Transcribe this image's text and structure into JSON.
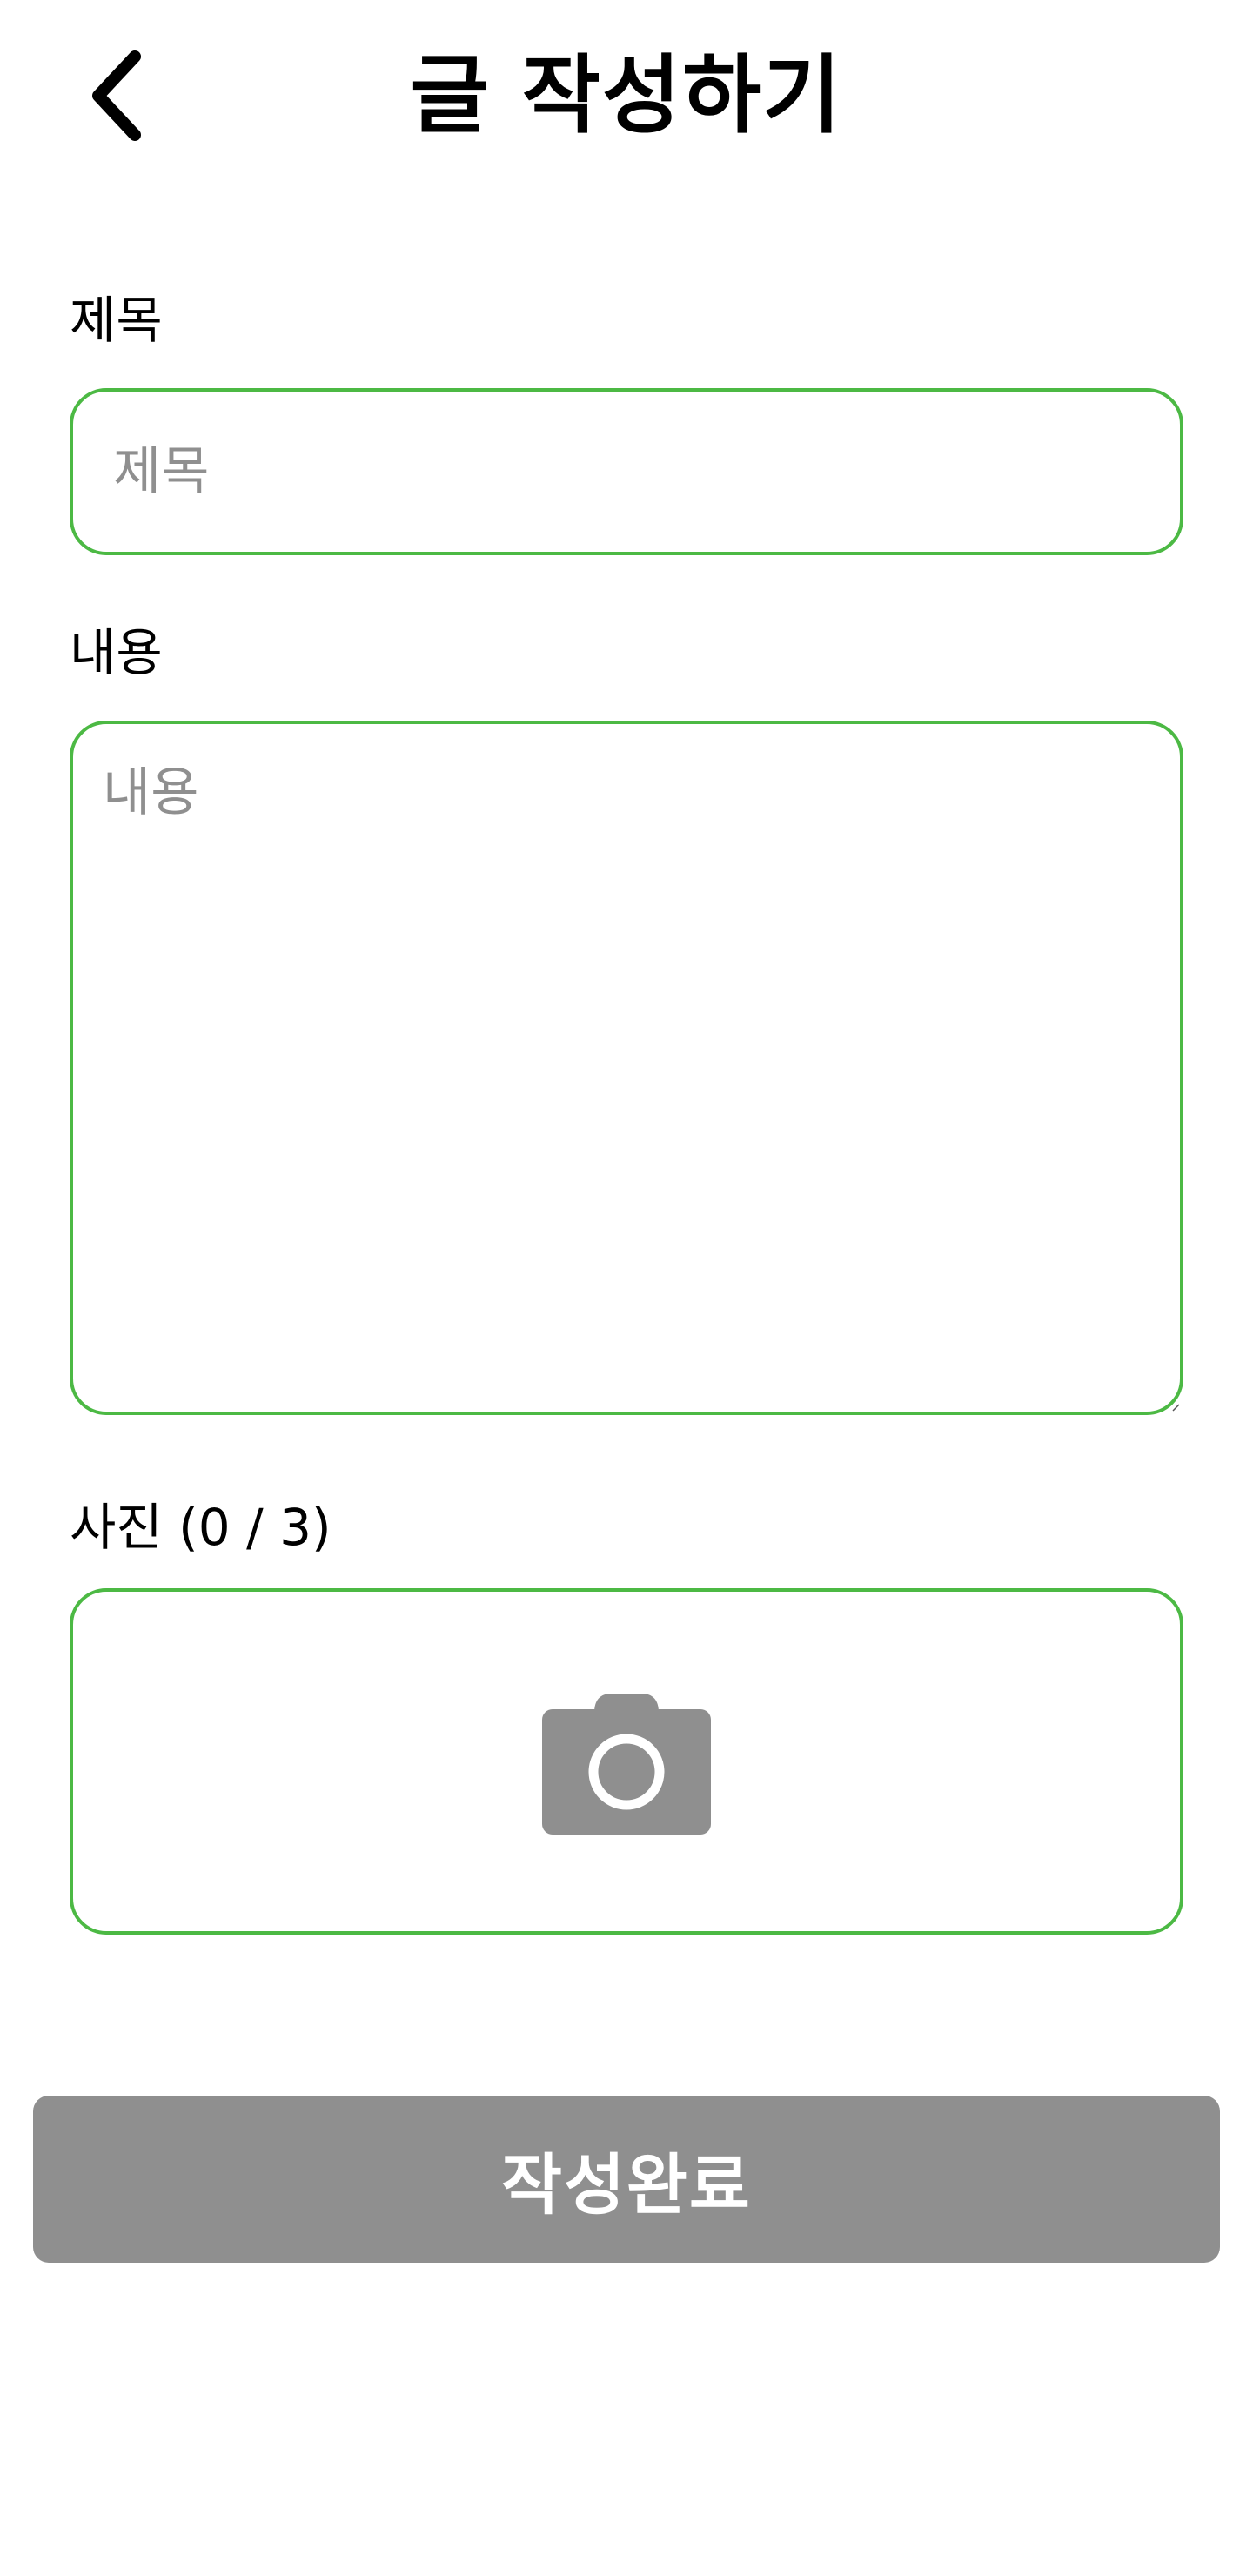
{
  "header": {
    "title": "글 작성하기",
    "back_icon": "chevron-left-icon"
  },
  "form": {
    "title_field": {
      "label": "제목",
      "placeholder": "제목",
      "value": ""
    },
    "content_field": {
      "label": "내용",
      "placeholder": "내용",
      "value": ""
    },
    "photo_field": {
      "label": "사진 (0 / 3)",
      "icon": "camera-icon",
      "count": 0,
      "max": 3
    }
  },
  "submit": {
    "label": "작성완료",
    "enabled": false
  },
  "colors": {
    "accent_border": "#4cb944",
    "disabled_button": "#8f8f8f",
    "placeholder": "#8f8f8f",
    "camera_icon": "#8f8f8f"
  }
}
